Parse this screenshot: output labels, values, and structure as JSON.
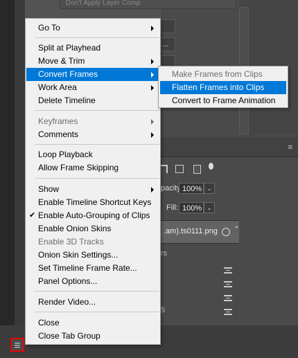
{
  "background": {
    "layer_comp": "Don't Apply Layer Comp",
    "btn_dots": "...",
    "layers_panel": {
      "opacity_label": "pacity:",
      "opacity_value": "100%",
      "fill_label": "Fill:",
      "fill_value": "100%",
      "layer_name": ".am).ts0111.png",
      "sub_text_1": "rs",
      "sub_text_2": "5"
    }
  },
  "menu": {
    "items": [
      {
        "label": "Go To"
      },
      {
        "label": "Split at Playhead"
      },
      {
        "label": "Move & Trim"
      },
      {
        "label": "Convert Frames"
      },
      {
        "label": "Work Area"
      },
      {
        "label": "Delete Timeline"
      },
      {
        "label": "Keyframes"
      },
      {
        "label": "Comments"
      },
      {
        "label": "Loop Playback"
      },
      {
        "label": "Allow Frame Skipping"
      },
      {
        "label": "Show"
      },
      {
        "label": "Enable Timeline Shortcut Keys"
      },
      {
        "label": "Enable Auto-Grouping of Clips"
      },
      {
        "label": "Enable Onion Skins"
      },
      {
        "label": "Enable 3D Tracks"
      },
      {
        "label": "Onion Skin Settings..."
      },
      {
        "label": "Set Timeline Frame Rate..."
      },
      {
        "label": "Panel Options..."
      },
      {
        "label": "Render Video..."
      },
      {
        "label": "Close"
      },
      {
        "label": "Close Tab Group"
      }
    ]
  },
  "submenu": {
    "items": [
      {
        "label": "Make Frames from Clips"
      },
      {
        "label": "Flatten Frames into Clips"
      },
      {
        "label": "Convert to Frame Animation"
      }
    ]
  },
  "colors": {
    "highlight": "#0078d7",
    "annotation_box": "#ee0000"
  },
  "icons": [
    "hamburger-menu-icon",
    "panel-menu-icon",
    "layer-comp-icon",
    "clip-stack-icon",
    "submenu-arrow-icon",
    "checkmark-icon"
  ]
}
